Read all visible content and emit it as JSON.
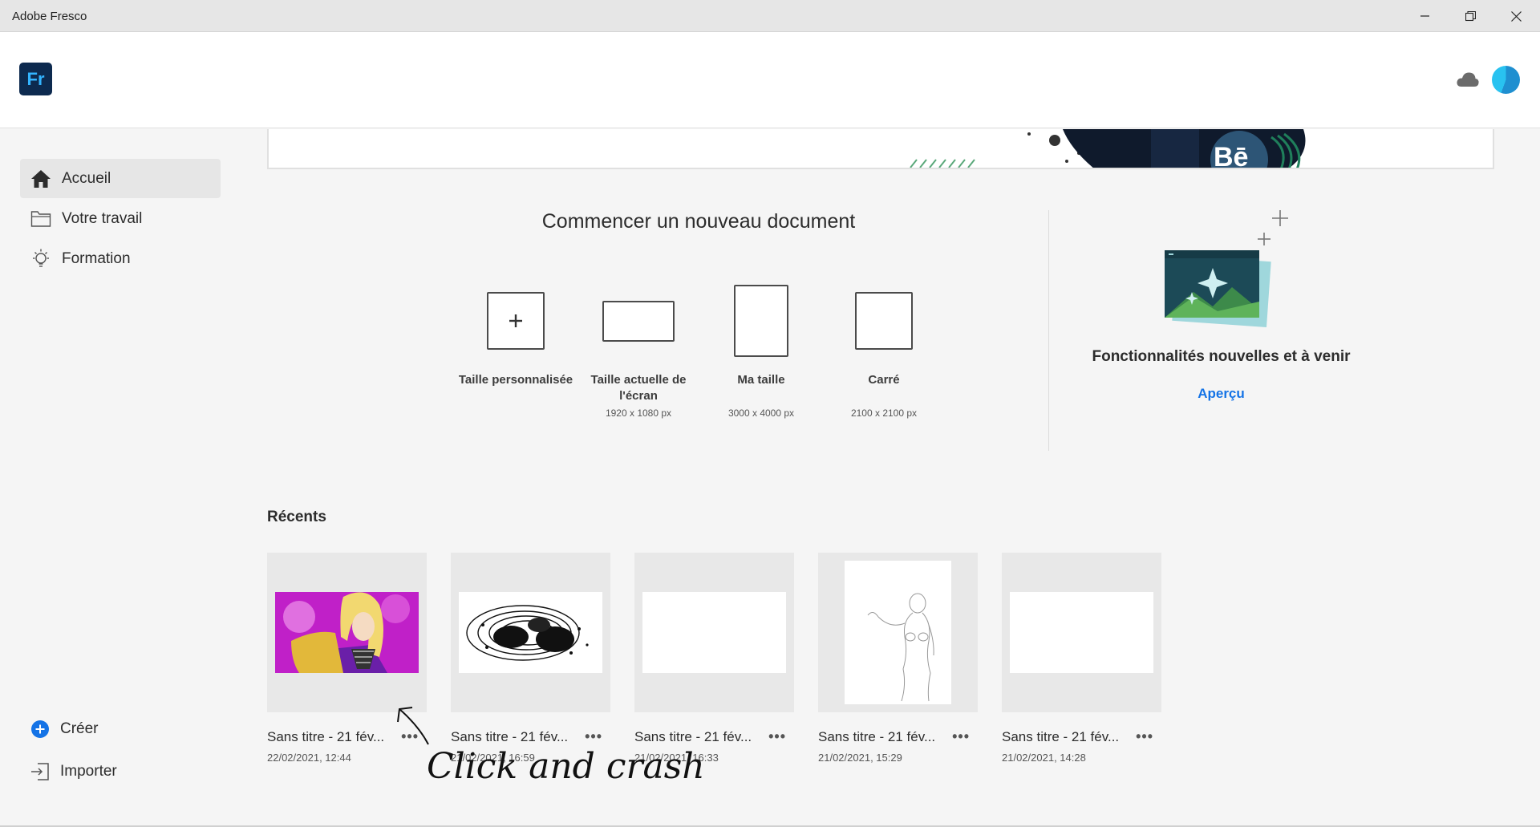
{
  "window": {
    "title": "Adobe Fresco"
  },
  "header": {
    "logo_text": "Fr",
    "cloud_icon": "cloud-icon",
    "avatar_colors": [
      "#1f8fd0",
      "#29c2f0"
    ]
  },
  "sidebar": {
    "items": [
      {
        "label": "Accueil",
        "icon": "home-icon",
        "active": true
      },
      {
        "label": "Votre travail",
        "icon": "folder-icon",
        "active": false
      },
      {
        "label": "Formation",
        "icon": "lightbulb-icon",
        "active": false
      }
    ],
    "actions": [
      {
        "label": "Créer",
        "icon": "plus-circle-icon"
      },
      {
        "label": "Importer",
        "icon": "import-icon"
      }
    ]
  },
  "new_document": {
    "title": "Commencer un nouveau document",
    "presets": [
      {
        "name": "Taille personnalisée",
        "size": ""
      },
      {
        "name": "Taille actuelle de l'écran",
        "size": "1920 x 1080 px"
      },
      {
        "name": "Ma taille",
        "size": "3000 x 4000 px"
      },
      {
        "name": "Carré",
        "size": "2100 x 2100 px"
      }
    ]
  },
  "features": {
    "title": "Fonctionnalités nouvelles et à venir",
    "link": "Aperçu"
  },
  "recents": {
    "title": "Récents",
    "items": [
      {
        "title": "Sans titre - 21 fév...",
        "date": "22/02/2021, 12:44",
        "thumb": "anime-portrait"
      },
      {
        "title": "Sans titre - 21 fév...",
        "date": "21/02/2021, 16:59",
        "thumb": "black-ink-pattern"
      },
      {
        "title": "Sans titre - 21 fév...",
        "date": "21/02/2021, 16:33",
        "thumb": "blank"
      },
      {
        "title": "Sans titre - 21 fév...",
        "date": "21/02/2021, 15:29",
        "thumb": "figure-sketch"
      },
      {
        "title": "Sans titre - 21 fév...",
        "date": "21/02/2021, 14:28",
        "thumb": "blank"
      }
    ]
  },
  "annotation": {
    "text": "Click and crash"
  },
  "colors": {
    "accent": "#1473e6",
    "logo_bg": "#0d2a4f",
    "logo_fg": "#33b4ff"
  }
}
